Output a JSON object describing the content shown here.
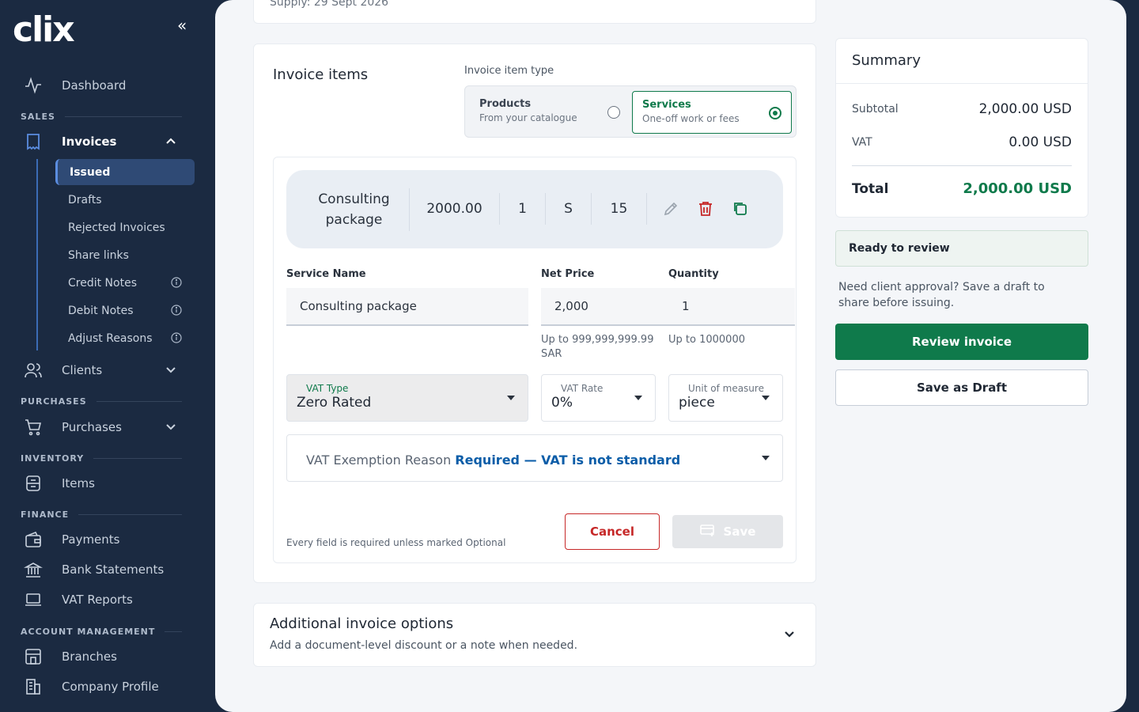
{
  "app": {
    "logo": "clix",
    "collapse_icon": "«"
  },
  "nav": {
    "dashboard": "Dashboard",
    "sales_label": "SALES",
    "invoices": "Invoices",
    "invoices_sub": [
      "Issued",
      "Drafts",
      "Rejected Invoices",
      "Share links",
      "Credit Notes",
      "Debit Notes",
      "Adjust Reasons"
    ],
    "clients": "Clients",
    "purchases_label": "PURCHASES",
    "purchases": "Purchases",
    "inventory_label": "INVENTORY",
    "items": "Items",
    "finance_label": "FINANCE",
    "payments": "Payments",
    "bank_statements": "Bank Statements",
    "vat_reports": "VAT Reports",
    "account_label": "ACCOUNT MANAGEMENT",
    "branches": "Branches",
    "company_profile": "Company Profile"
  },
  "header": {
    "supply": "Supply: 29 Sept 2026"
  },
  "invoice_items": {
    "title": "Invoice items",
    "type_label": "Invoice item type",
    "options": [
      {
        "title": "Products",
        "subtitle": "From your catalogue",
        "selected": false
      },
      {
        "title": "Services",
        "subtitle": "One-off work or fees",
        "selected": true
      }
    ],
    "line": {
      "name_line1": "Consulting",
      "name_line2": "package",
      "price": "2000.00",
      "quantity": "1",
      "vat_code": "S",
      "vat_rate": "15"
    },
    "form": {
      "service_name_label": "Service Name",
      "service_name_value": "Consulting package",
      "net_price_label": "Net Price",
      "net_price_value": "2,000",
      "net_price_hint1": "Up to 999,999,999.99",
      "net_price_hint2": "SAR",
      "quantity_label": "Quantity",
      "quantity_value": "1",
      "quantity_hint": "Up to 1000000",
      "vat_type_label": "VAT Type",
      "vat_type_value": "Zero Rated",
      "vat_rate_label": "VAT Rate",
      "vat_rate_value": "0%",
      "uom_label": "Unit of measure",
      "uom_value": "piece",
      "exemption_label": "VAT Exemption Reason",
      "exemption_required": "Required — VAT is not standard",
      "note": "Every field is required unless marked Optional",
      "cancel": "Cancel",
      "save": "Save"
    }
  },
  "additional": {
    "title": "Additional invoice options",
    "subtitle": "Add a document-level discount or a note when needed."
  },
  "summary": {
    "title": "Summary",
    "subtotal_label": "Subtotal",
    "subtotal_value": "2,000.00 USD",
    "vat_label": "VAT",
    "vat_value": "0.00 USD",
    "total_label": "Total",
    "total_value": "2,000.00 USD",
    "status": "Ready to review",
    "draft_note": "Need client approval? Save a draft to share before issuing.",
    "review_button": "Review invoice",
    "draft_button": "Save as Draft"
  },
  "colors": {
    "sidebar": "#1b2a41",
    "accent_green": "#0f7a4b",
    "danger": "#c62828",
    "link_blue": "#0b5da8"
  }
}
